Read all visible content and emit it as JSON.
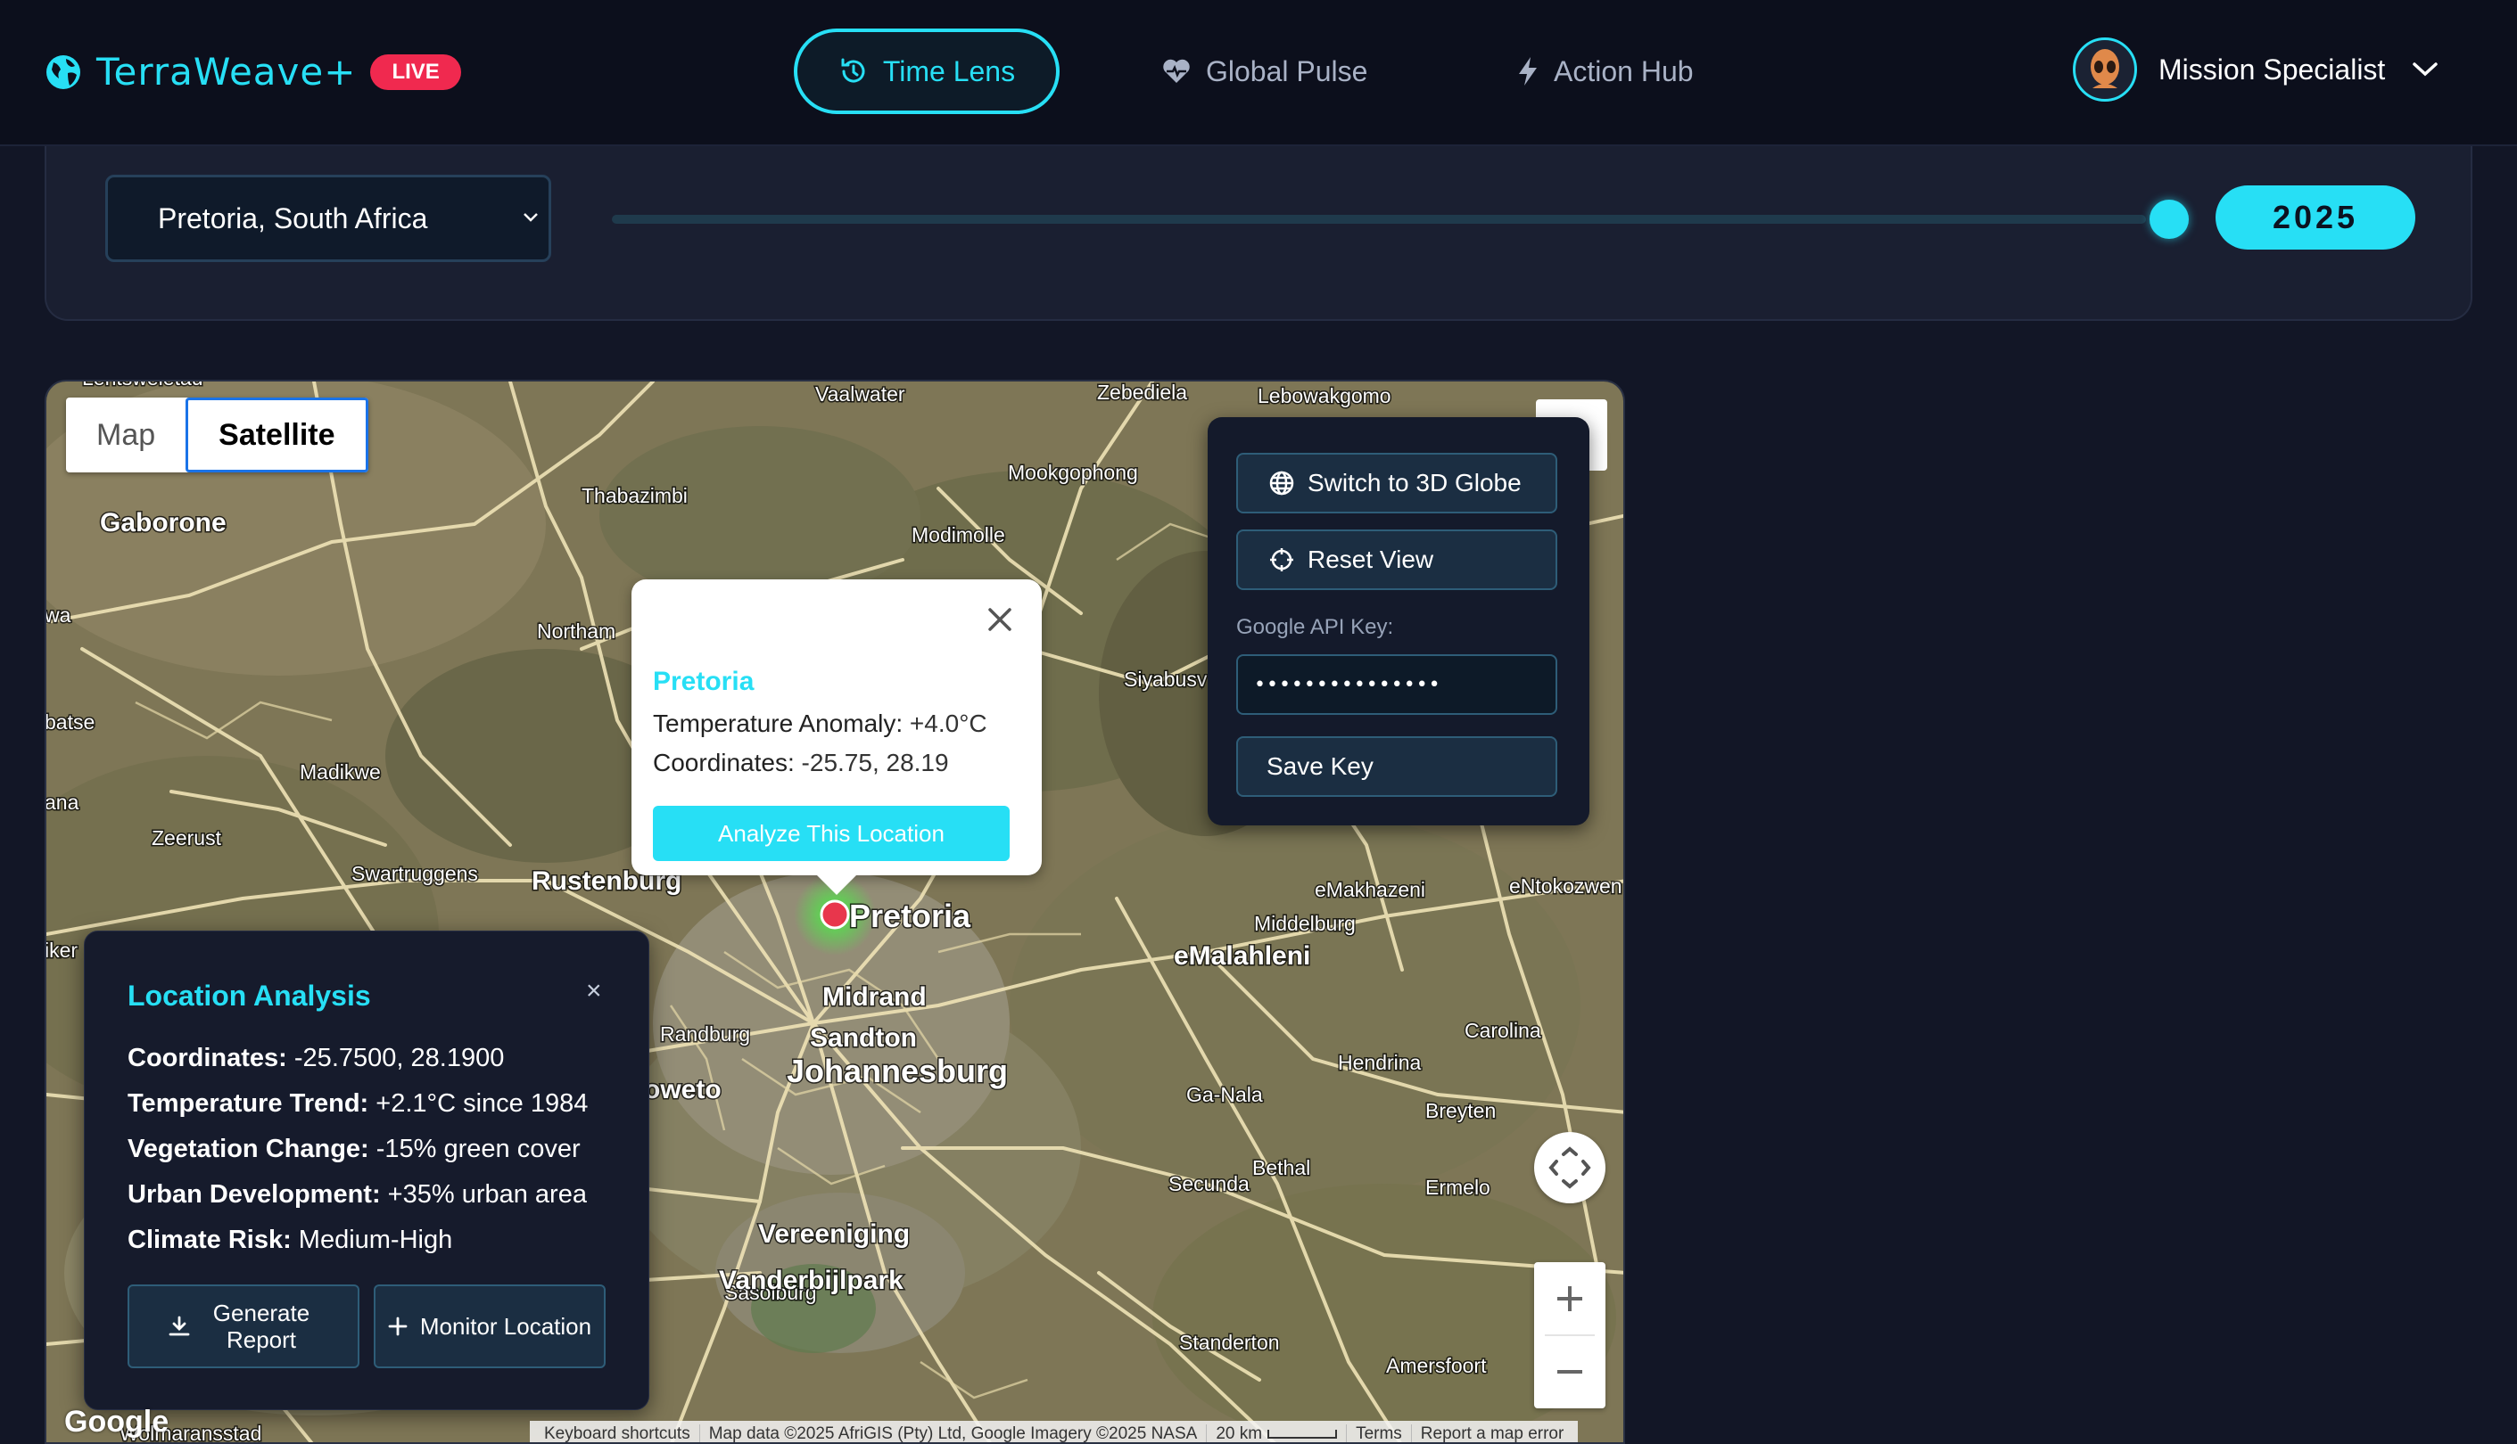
{
  "header": {
    "brand": "TerraWeave+",
    "live_badge": "LIVE",
    "tabs": [
      {
        "label": "Time Lens",
        "icon": "history-icon",
        "active": true
      },
      {
        "label": "Global Pulse",
        "icon": "heart-pulse-icon",
        "active": false
      },
      {
        "label": "Action Hub",
        "icon": "lightning-icon",
        "active": false
      }
    ],
    "user_name": "Mission Specialist"
  },
  "controls": {
    "location": "Pretoria, South Africa",
    "year": "2025",
    "year_slider_fraction": 1.0
  },
  "map": {
    "type_buttons": [
      "Map",
      "Satellite"
    ],
    "selected_type": "Satellite",
    "labels": {
      "gaborone": "Gaborone",
      "vaalwater": "Vaalwater",
      "zebediela": "Zebediela",
      "lebowakgomo": "Lebowakgomo",
      "mookgophong": "Mookgophong",
      "thabazimbi": "Thabazimbi",
      "modimolle": "Modimolle",
      "northam": "Northam",
      "siyabuswa": "Siyabusv",
      "madikwe": "Madikwe",
      "zeerust": "Zeerust",
      "swartruggens": "Swartruggens",
      "rustenburg": "Rustenburg",
      "pretoria": "Pretoria",
      "emakhazeni": "eMakhazeni",
      "entokozweni": "eNtokozwen",
      "middelburg": "Middelburg",
      "emalahleni": "eMalahleni",
      "midrand": "Midrand",
      "randburg": "Randburg",
      "sandton": "Sandton",
      "johannesburg": "Johannesburg",
      "carolina": "Carolina",
      "hendrina": "Hendrina",
      "ganala": "Ga-Nala",
      "breyten": "Breyten",
      "bethal": "Bethal",
      "secunda": "Secunda",
      "ermelo": "Ermelo",
      "vereeniging": "Vereeniging",
      "vanderbijlpark": "Vanderbijlpark",
      "sasolburg": "Sasolburg",
      "standerton": "Standerton",
      "amersfoort": "Amersfoort",
      "soweto": "oweto",
      "lentsweletau": "Lentsweletau",
      "batse": "batse",
      "wa": "wa",
      "ana": "ana",
      "iker": "iker",
      "wolmaransstad": "Wolmaransstad"
    },
    "google_logo": "Google",
    "attribution": [
      "Keyboard shortcuts",
      "Map data ©2025 AfriGIS (Pty) Ltd, Google Imagery ©2025 NASA",
      "20 km",
      "Terms",
      "Report a map error"
    ]
  },
  "control_panel": {
    "switch_globe": "Switch to 3D Globe",
    "reset_view": "Reset View",
    "api_label": "Google API Key:",
    "api_value": "•••••••••••••••",
    "save_key": "Save Key"
  },
  "popup": {
    "title": "Pretoria",
    "anomaly_label": "Temperature Anomaly:",
    "anomaly_value": " +4.0°C",
    "coords_label": "Coordinates:",
    "coords_value": " -25.75, 28.19",
    "button": "Analyze This Location"
  },
  "analysis": {
    "title": "Location Analysis",
    "close": "×",
    "rows": [
      {
        "label": "Coordinates:",
        "value": " -25.7500, 28.1900"
      },
      {
        "label": "Temperature Trend:",
        "value": " +2.1°C since 1984"
      },
      {
        "label": "Vegetation Change:",
        "value": " -15% green cover"
      },
      {
        "label": "Urban Development:",
        "value": " +35% urban area"
      },
      {
        "label": "Climate Risk:",
        "value": " Medium-High"
      }
    ],
    "generate_button": "Generate Report",
    "monitor_button": "Monitor Location"
  },
  "colors": {
    "accent": "#27dff5",
    "live": "#f0294f",
    "background": "#121626",
    "marker": "#e8364c"
  }
}
